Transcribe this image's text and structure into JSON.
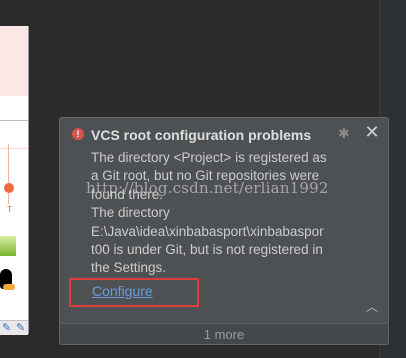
{
  "notification": {
    "title": "VCS root configuration problems",
    "icon": "error-icon",
    "message_lines": [
      "The directory <Project> is registered as",
      "a Git root, but no Git repositories were",
      "found there.",
      "The directory",
      "E:\\Java\\idea\\xinbabasport\\xinbabaspor",
      "t00 is under Git, but is not registered in",
      "the Settings."
    ],
    "link_label": "Configure",
    "more_label": "1 more"
  },
  "watermark": "http://blog.csdn.net/erlian1992",
  "colors": {
    "balloon_bg": "#4e5153",
    "link": "#6a9cdb",
    "highlight": "#e03b3b",
    "error": "#d9534f"
  }
}
